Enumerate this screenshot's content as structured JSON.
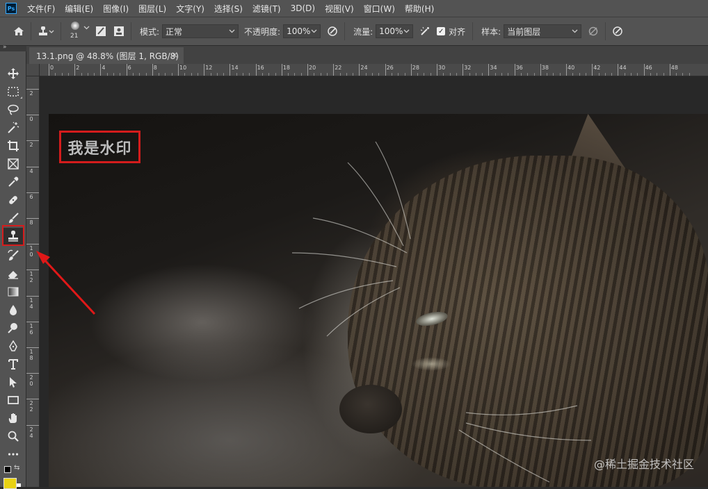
{
  "app": {
    "logo": "Ps"
  },
  "menu": [
    "文件(F)",
    "编辑(E)",
    "图像(I)",
    "图层(L)",
    "文字(Y)",
    "选择(S)",
    "滤镜(T)",
    "3D(D)",
    "视图(V)",
    "窗口(W)",
    "帮助(H)"
  ],
  "options": {
    "brush_size": "21",
    "mode_label": "模式:",
    "mode_value": "正常",
    "opacity_label": "不透明度:",
    "opacity_value": "100%",
    "flow_label": "流量:",
    "flow_value": "100%",
    "aligned_label": "对齐",
    "aligned_checked": true,
    "sample_label": "样本:",
    "sample_value": "当前图层"
  },
  "document_tab": {
    "title": "13.1.png @ 48.8% (图层 1, RGB/8)",
    "close": "×"
  },
  "ruler": {
    "top_labels": [
      "0",
      "2",
      "4",
      "6",
      "8",
      "10",
      "12",
      "14",
      "16",
      "18",
      "20",
      "22",
      "24",
      "26",
      "28",
      "30",
      "32",
      "34",
      "36",
      "38",
      "40",
      "42",
      "44",
      "46",
      "48"
    ],
    "left_labels": [
      "2",
      "0",
      "2",
      "4",
      "6",
      "8",
      "1 0",
      "1 2",
      "1 4",
      "1 6",
      "1 8",
      "2 0",
      "2 2",
      "2 4"
    ]
  },
  "canvas": {
    "watermark_text": "我是水印",
    "site_watermark": "@稀土掘金技术社区"
  },
  "tools": [
    "move-tool",
    "marquee-tool",
    "lasso-tool",
    "magic-wand-tool",
    "crop-tool",
    "frame-tool",
    "eyedropper-tool",
    "healing-brush-tool",
    "brush-tool",
    "clone-stamp-tool",
    "history-brush-tool",
    "eraser-tool",
    "gradient-tool",
    "blur-tool",
    "dodge-tool",
    "pen-tool",
    "type-tool",
    "path-selection-tool",
    "rectangle-tool",
    "hand-tool",
    "zoom-tool",
    "more-tools"
  ],
  "colors": {
    "foreground": "#e8d214",
    "background": "#ffffff",
    "highlight": "#d41c1c"
  }
}
